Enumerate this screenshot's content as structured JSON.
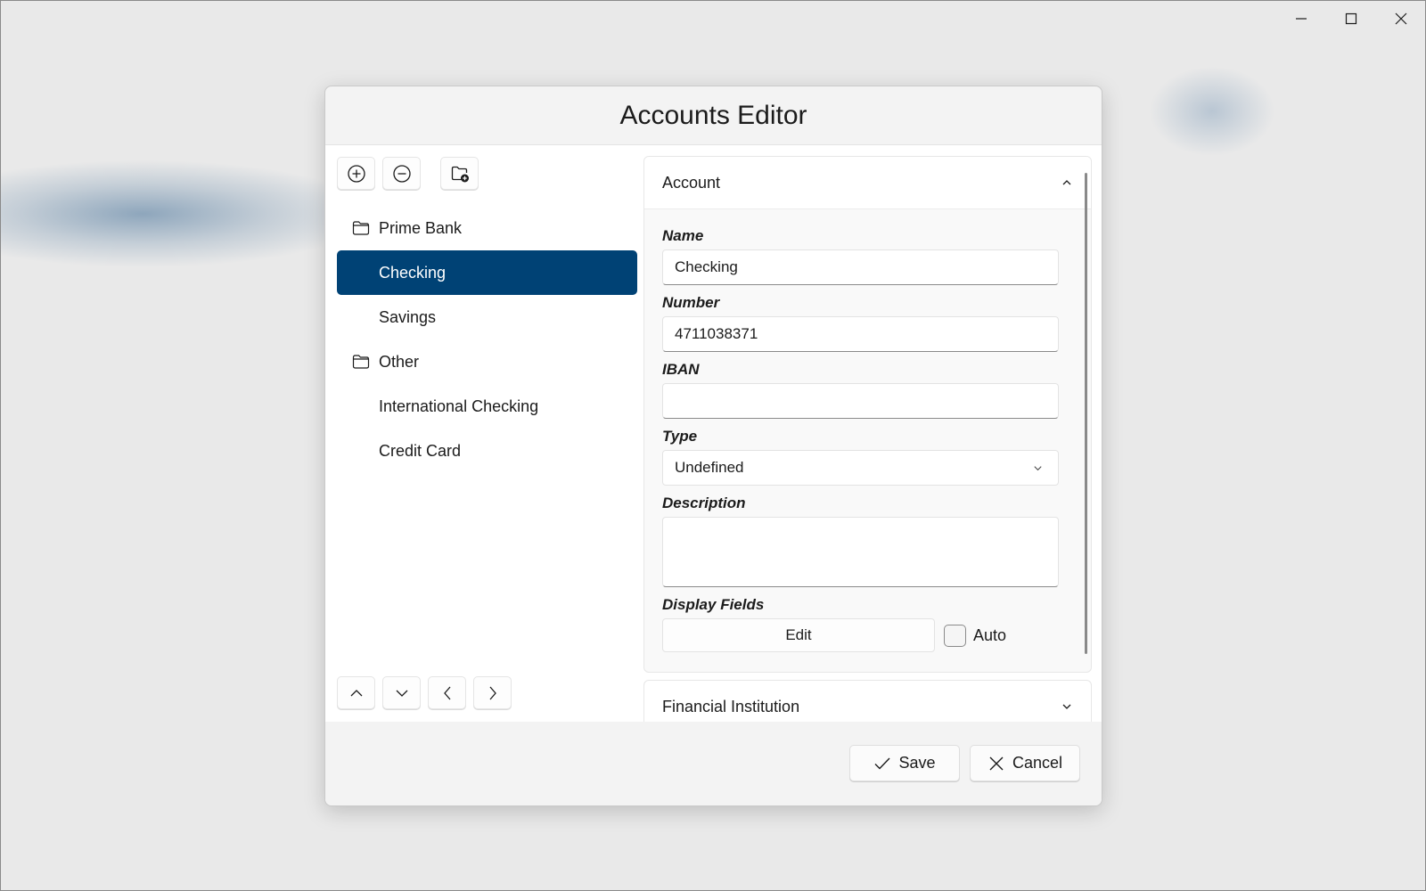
{
  "window": {
    "caption_buttons": [
      {
        "name": "minimize",
        "icon": "minimize-icon"
      },
      {
        "name": "maximize",
        "icon": "maximize-icon"
      },
      {
        "name": "close",
        "icon": "close-icon"
      }
    ]
  },
  "dialog": {
    "title": "Accounts Editor",
    "toolbar": [
      {
        "name": "add-account",
        "icon": "plus-circle-icon"
      },
      {
        "name": "remove-account",
        "icon": "minus-circle-icon"
      },
      {
        "name": "add-folder",
        "icon": "folder-add-icon"
      }
    ],
    "tree": [
      {
        "label": "Prime Bank",
        "type": "folder",
        "selected": false
      },
      {
        "label": "Checking",
        "type": "account",
        "selected": true
      },
      {
        "label": "Savings",
        "type": "account",
        "selected": false
      },
      {
        "label": "Other",
        "type": "folder",
        "selected": false
      },
      {
        "label": "International Checking",
        "type": "account",
        "selected": false
      },
      {
        "label": "Credit Card",
        "type": "account",
        "selected": false
      }
    ],
    "nav_buttons": [
      {
        "name": "move-up",
        "icon": "chevron-up-icon"
      },
      {
        "name": "move-down",
        "icon": "chevron-down-icon"
      },
      {
        "name": "outdent",
        "icon": "chevron-left-icon"
      },
      {
        "name": "indent",
        "icon": "chevron-right-icon"
      }
    ],
    "account_section": {
      "header": "Account",
      "expanded": true,
      "fields": {
        "name_label": "Name",
        "name_value": "Checking",
        "number_label": "Number",
        "number_value": "4711038371",
        "iban_label": "IBAN",
        "iban_value": "",
        "type_label": "Type",
        "type_value": "Undefined",
        "description_label": "Description",
        "description_value": "",
        "display_fields_label": "Display Fields",
        "edit_button": "Edit",
        "auto_label": "Auto",
        "auto_checked": false
      }
    },
    "institution_section": {
      "header": "Financial Institution",
      "expanded": false
    },
    "footer": {
      "save_label": "Save",
      "cancel_label": "Cancel"
    }
  }
}
